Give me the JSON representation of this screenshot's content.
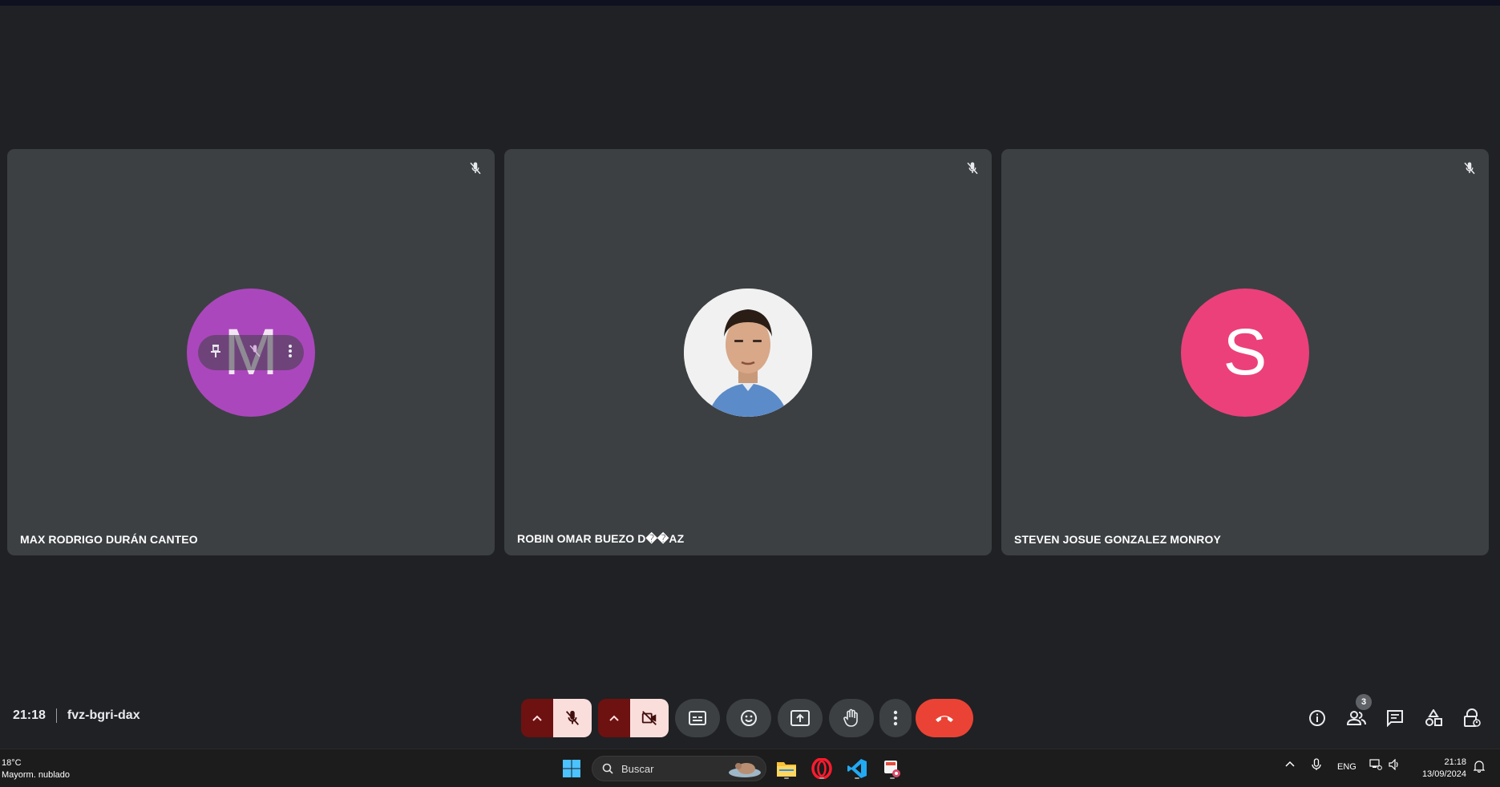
{
  "meeting": {
    "time": "21:18",
    "code": "fvz-bgri-dax",
    "participant_count": "3"
  },
  "participants": [
    {
      "name": "MAX RODRIGO DURÁN CANTEO",
      "initial": "M",
      "avatar_color": "#ab47bc",
      "muted": true
    },
    {
      "name": "ROBIN OMAR BUEZO D��AZ",
      "initial": "",
      "avatar_color": "#f1f1f1",
      "muted": true
    },
    {
      "name": "STEVEN JOSUE GONZALEZ MONROY",
      "initial": "S",
      "avatar_color": "#ec407a",
      "muted": true
    }
  ],
  "controls": {
    "mic_state": "muted",
    "camera_state": "off",
    "buttons": [
      "mic-options",
      "mic-toggle",
      "camera-options",
      "camera-toggle",
      "captions",
      "emoji",
      "present",
      "raise-hand",
      "more-options",
      "leave-call"
    ]
  },
  "colors": {
    "background": "#202124",
    "tile": "#3c4043",
    "end_call": "#ea4335",
    "toggle_off_bg": "#f9dedc",
    "toggle_off_dark": "#6e1111"
  },
  "taskbar": {
    "temperature": "18°C",
    "weather": "Mayorm. nublado",
    "search_placeholder": "Buscar",
    "language": "ENG",
    "time": "21:18",
    "date": "13/09/2024"
  }
}
